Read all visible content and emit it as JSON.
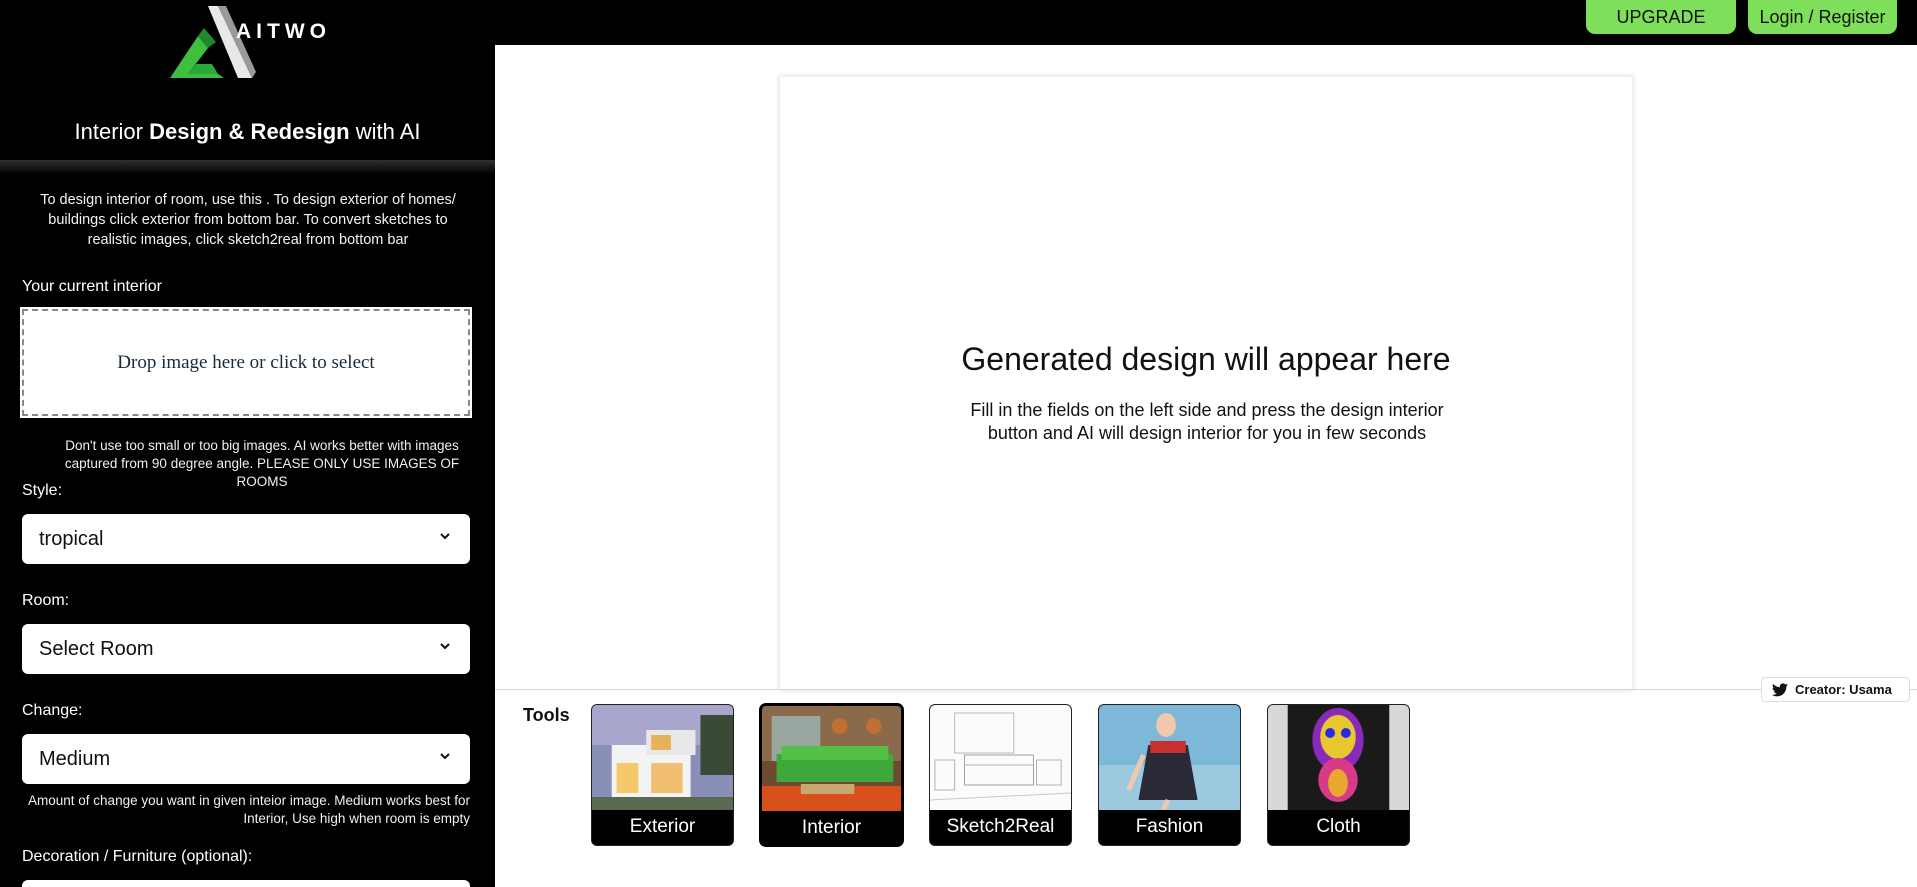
{
  "header": {
    "upgrade_label": "UPGRADE",
    "login_label": "Login / Register"
  },
  "brand": {
    "logo_text": "AITWO",
    "title_prefix": "Interior ",
    "title_bold": "Design & Redesign",
    "title_suffix": " with AI"
  },
  "sidebar": {
    "intro": "To design interior of room, use this . To design exterior of homes/ buildings click exterior from bottom bar. To convert sketches to realistic images, click sketch2real from bottom bar",
    "upload_label": "Your current interior",
    "dropzone_text": "Drop image here or click to select",
    "upload_hint": "Don't use too small or too big images. AI works better with images captured from 90 degree angle. PLEASE ONLY USE IMAGES OF ROOMS",
    "style_label": "Style:",
    "style_value": "tropical",
    "room_label": "Room:",
    "room_value": "Select Room",
    "change_label": "Change:",
    "change_value": "Medium",
    "change_hint": "Amount of change you want in given inteior image. Medium works best for Interior, Use high when room is empty",
    "decoration_label": "Decoration / Furniture (optional):"
  },
  "main": {
    "placeholder_title": "Generated design will appear here",
    "placeholder_desc": "Fill in the fields on the left side and press the design interior button and AI will design interior for you in few seconds"
  },
  "tools": {
    "label": "Tools",
    "items": [
      {
        "label": "Exterior",
        "icon": "exterior-thumbnail",
        "active": false
      },
      {
        "label": "Interior",
        "icon": "interior-thumbnail",
        "active": true
      },
      {
        "label": "Sketch2Real",
        "icon": "sketch-thumbnail",
        "active": false
      },
      {
        "label": "Fashion",
        "icon": "fashion-thumbnail",
        "active": false
      },
      {
        "label": "Cloth",
        "icon": "cloth-thumbnail",
        "active": false
      }
    ]
  },
  "creator": {
    "label": "Creator: Usama",
    "icon": "twitter-icon"
  },
  "colors": {
    "accent": "#7ee05a",
    "sidebar_bg": "#000000",
    "logo_green": "#3fbf3f"
  }
}
